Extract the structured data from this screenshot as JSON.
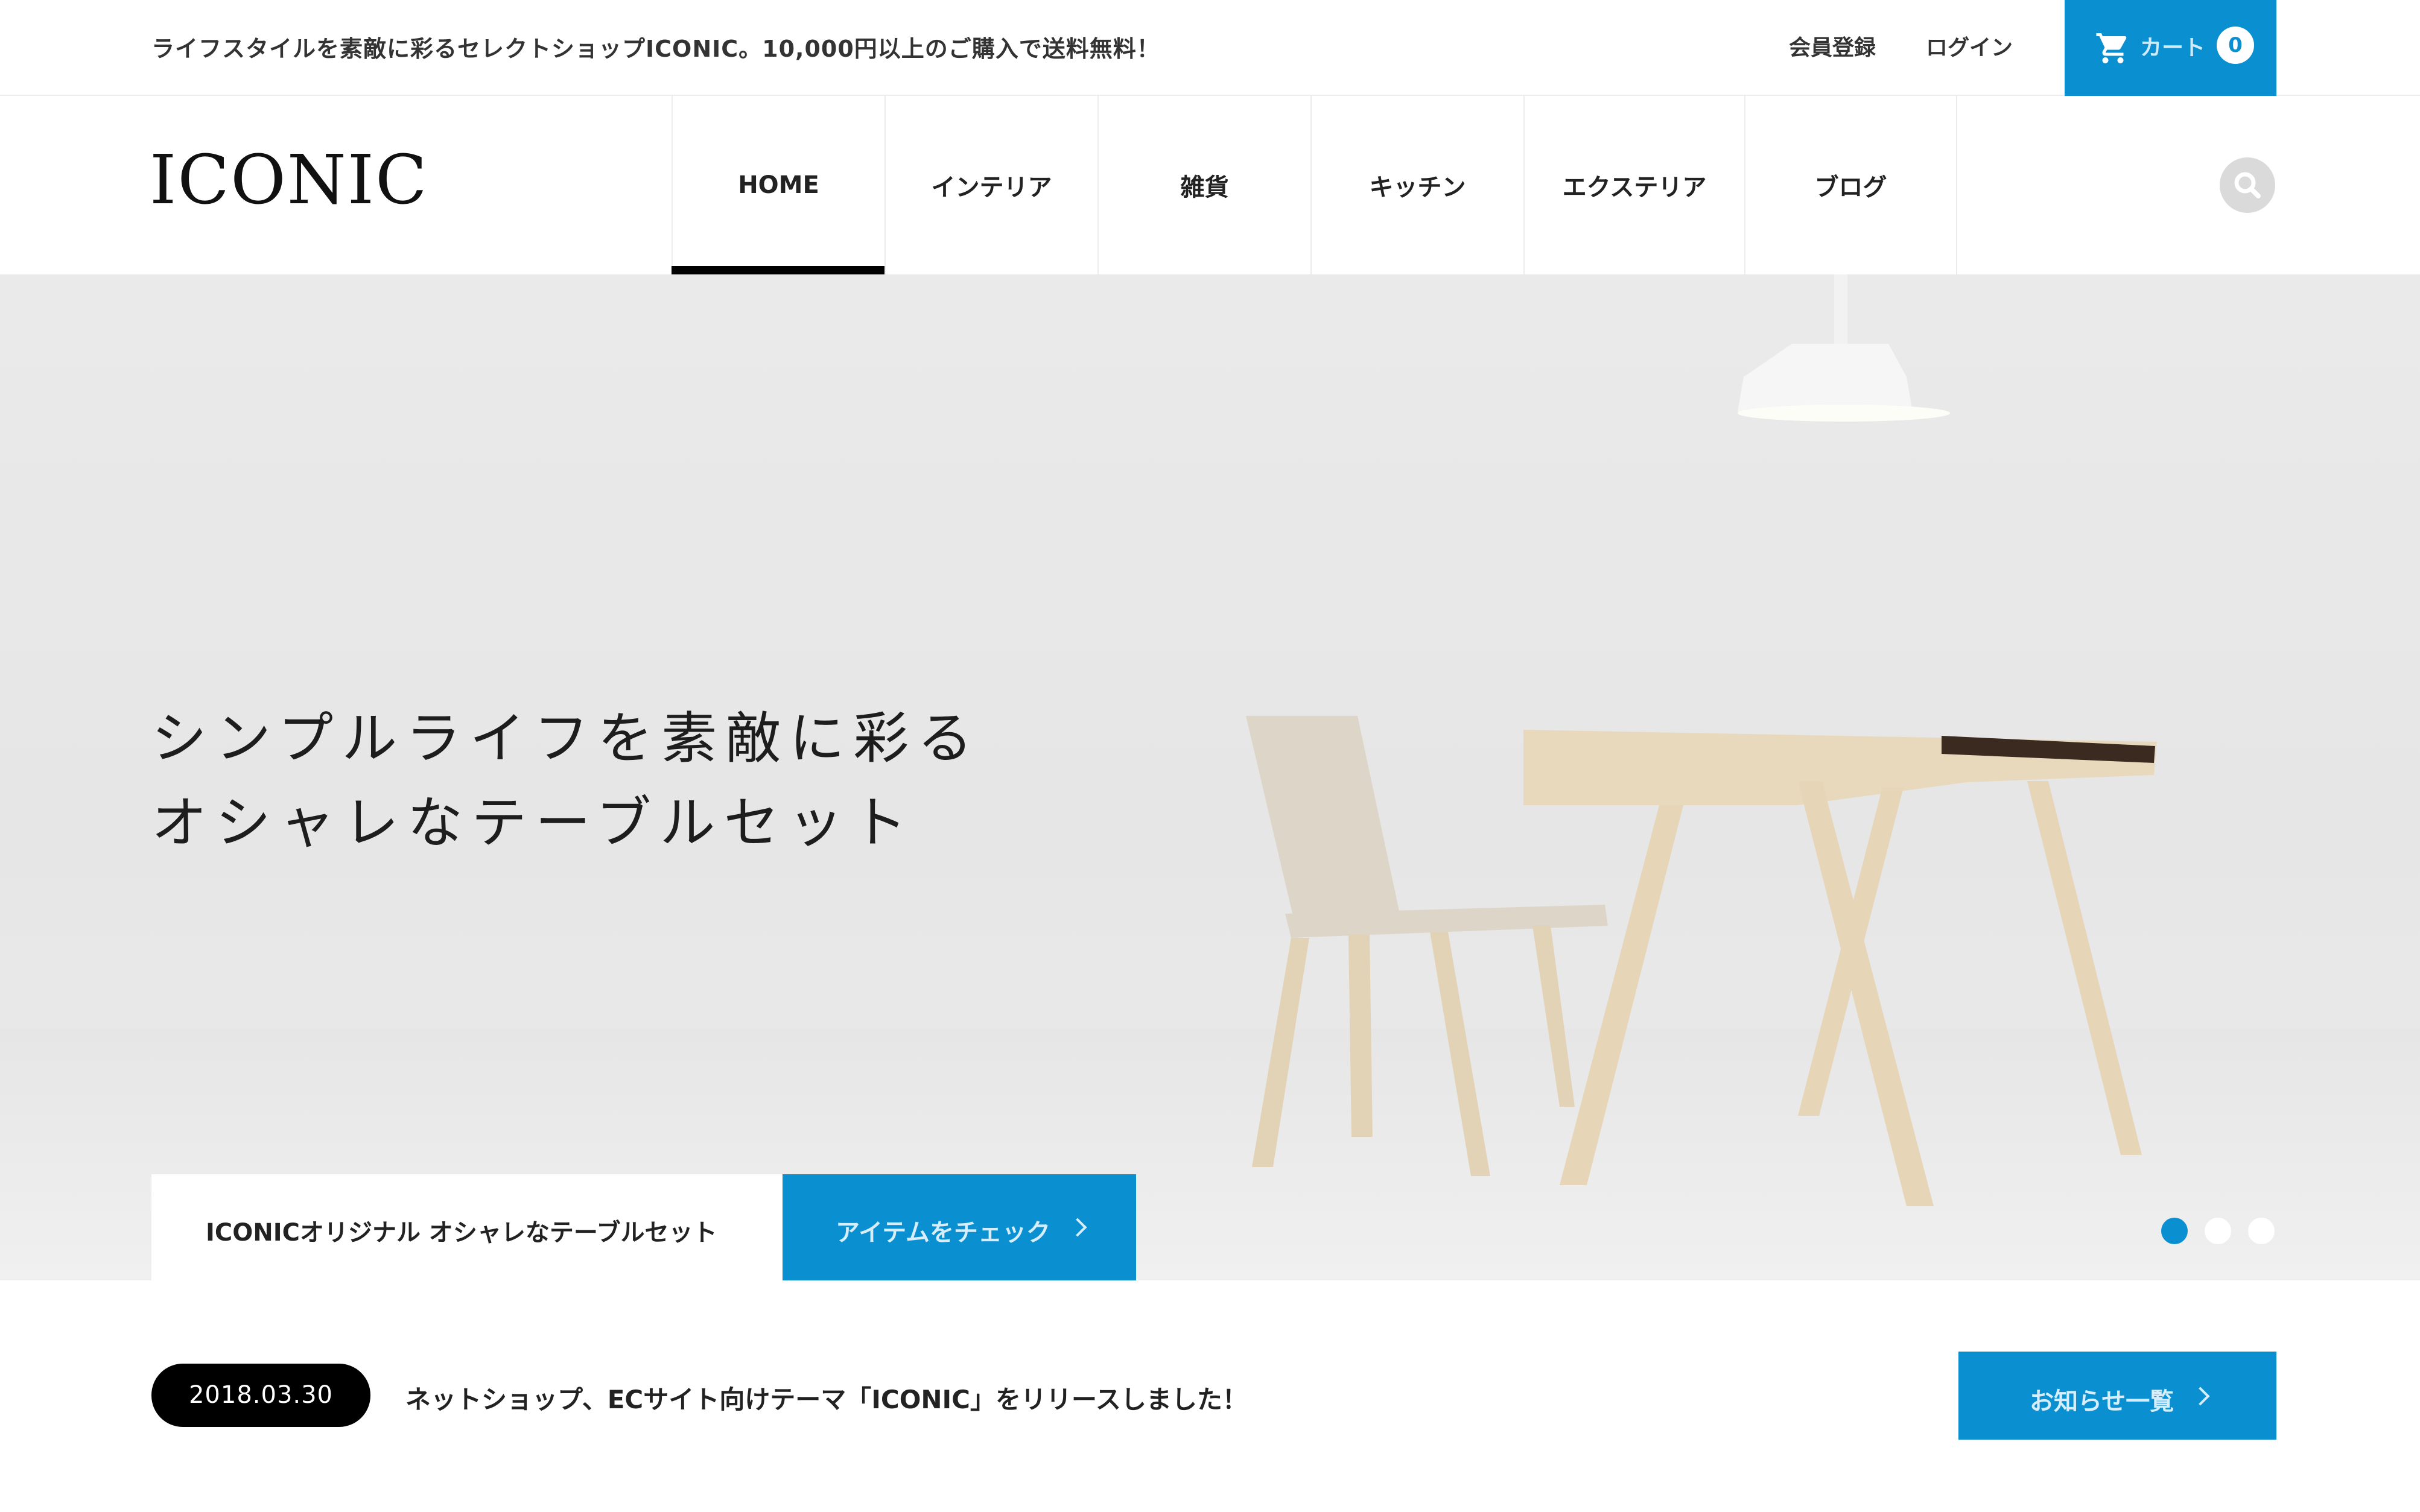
{
  "topbar": {
    "tagline": "ライフスタイルを素敵に彩るセレクトショップICONIC。10,000円以上のご購入で送料無料！",
    "register_label": "会員登録",
    "login_label": "ログイン",
    "cart": {
      "label": "カート",
      "count": "0",
      "icon": "cart-icon"
    }
  },
  "header": {
    "logo": "ICONIC",
    "nav": [
      {
        "label": "HOME",
        "active": true
      },
      {
        "label": "インテリア",
        "active": false
      },
      {
        "label": "雑貨",
        "active": false
      },
      {
        "label": "キッチン",
        "active": false
      },
      {
        "label": "エクステリア",
        "active": false
      },
      {
        "label": "ブログ",
        "active": false
      }
    ],
    "search_icon": "search-icon"
  },
  "hero": {
    "headline_line1": "シンプルライフを素敵に彩る",
    "headline_line2": "オシャレなテーブルセット",
    "caption": "ICONICオリジナル オシャレなテーブルセット",
    "cta_label": "アイテムをチェック",
    "slides_total": 3,
    "active_slide": 1
  },
  "news": {
    "date": "2018.03.30",
    "text": "ネットショップ、ECサイト向けテーマ「ICONIC」をリリースしました！",
    "button_label": "お知らせ一覧"
  },
  "colors": {
    "accent": "#0a8fd1",
    "text": "#222222",
    "date_pill": "#000000"
  }
}
